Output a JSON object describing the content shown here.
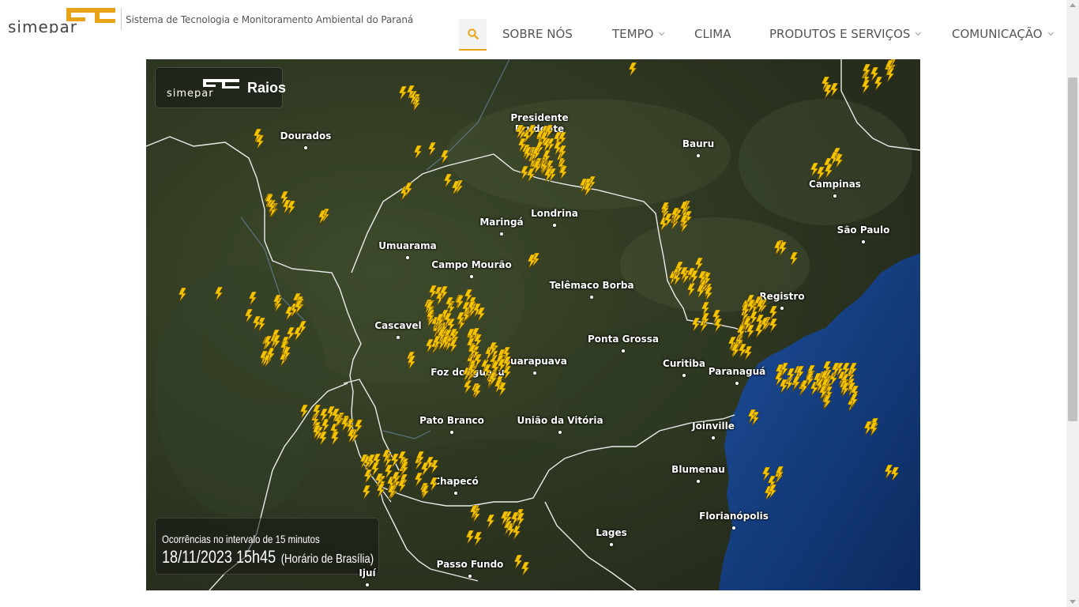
{
  "header": {
    "tagline": "Sistema de Tecnologia e Monitoramento Ambiental do Paraná",
    "nav": [
      {
        "label": "SOBRE NÓS",
        "dropdown": false
      },
      {
        "label": "TEMPO",
        "dropdown": true
      },
      {
        "label": "CLIMA",
        "dropdown": false
      },
      {
        "label": "PRODUTOS E SERVIÇOS",
        "dropdown": true
      },
      {
        "label": "COMUNICAÇÃO",
        "dropdown": true
      }
    ],
    "accent_color": "#e8a317"
  },
  "map": {
    "badge_title": "Raios",
    "info": {
      "interval_text": "Ocorrências no intervalo de 15 minutos",
      "datetime": "18/11/2023 15h45",
      "timezone": "(Horário de Brasília)"
    },
    "cities": [
      {
        "name": "Dourados"
      },
      {
        "name": "Presidente\nPrudente"
      },
      {
        "name": "Bauru"
      },
      {
        "name": "Campinas"
      },
      {
        "name": "São Paulo"
      },
      {
        "name": "Maringá"
      },
      {
        "name": "Londrina"
      },
      {
        "name": "Umuarama"
      },
      {
        "name": "Campo Mourão"
      },
      {
        "name": "Telêmaco Borba"
      },
      {
        "name": "Registro"
      },
      {
        "name": "Cascavel"
      },
      {
        "name": "Ponta Grossa"
      },
      {
        "name": "Guarapuava"
      },
      {
        "name": "Curitiba"
      },
      {
        "name": "Paranaguá"
      },
      {
        "name": "Foz do Iguaçu"
      },
      {
        "name": "Pato Branco"
      },
      {
        "name": "União da Vitória"
      },
      {
        "name": "Joinville"
      },
      {
        "name": "Chapecó"
      },
      {
        "name": "Blumenau"
      },
      {
        "name": "Florianópolis"
      },
      {
        "name": "Lages"
      },
      {
        "name": "Passo Fundo"
      },
      {
        "name": "Ijuí"
      }
    ],
    "lightning_color": "#f5c400"
  }
}
